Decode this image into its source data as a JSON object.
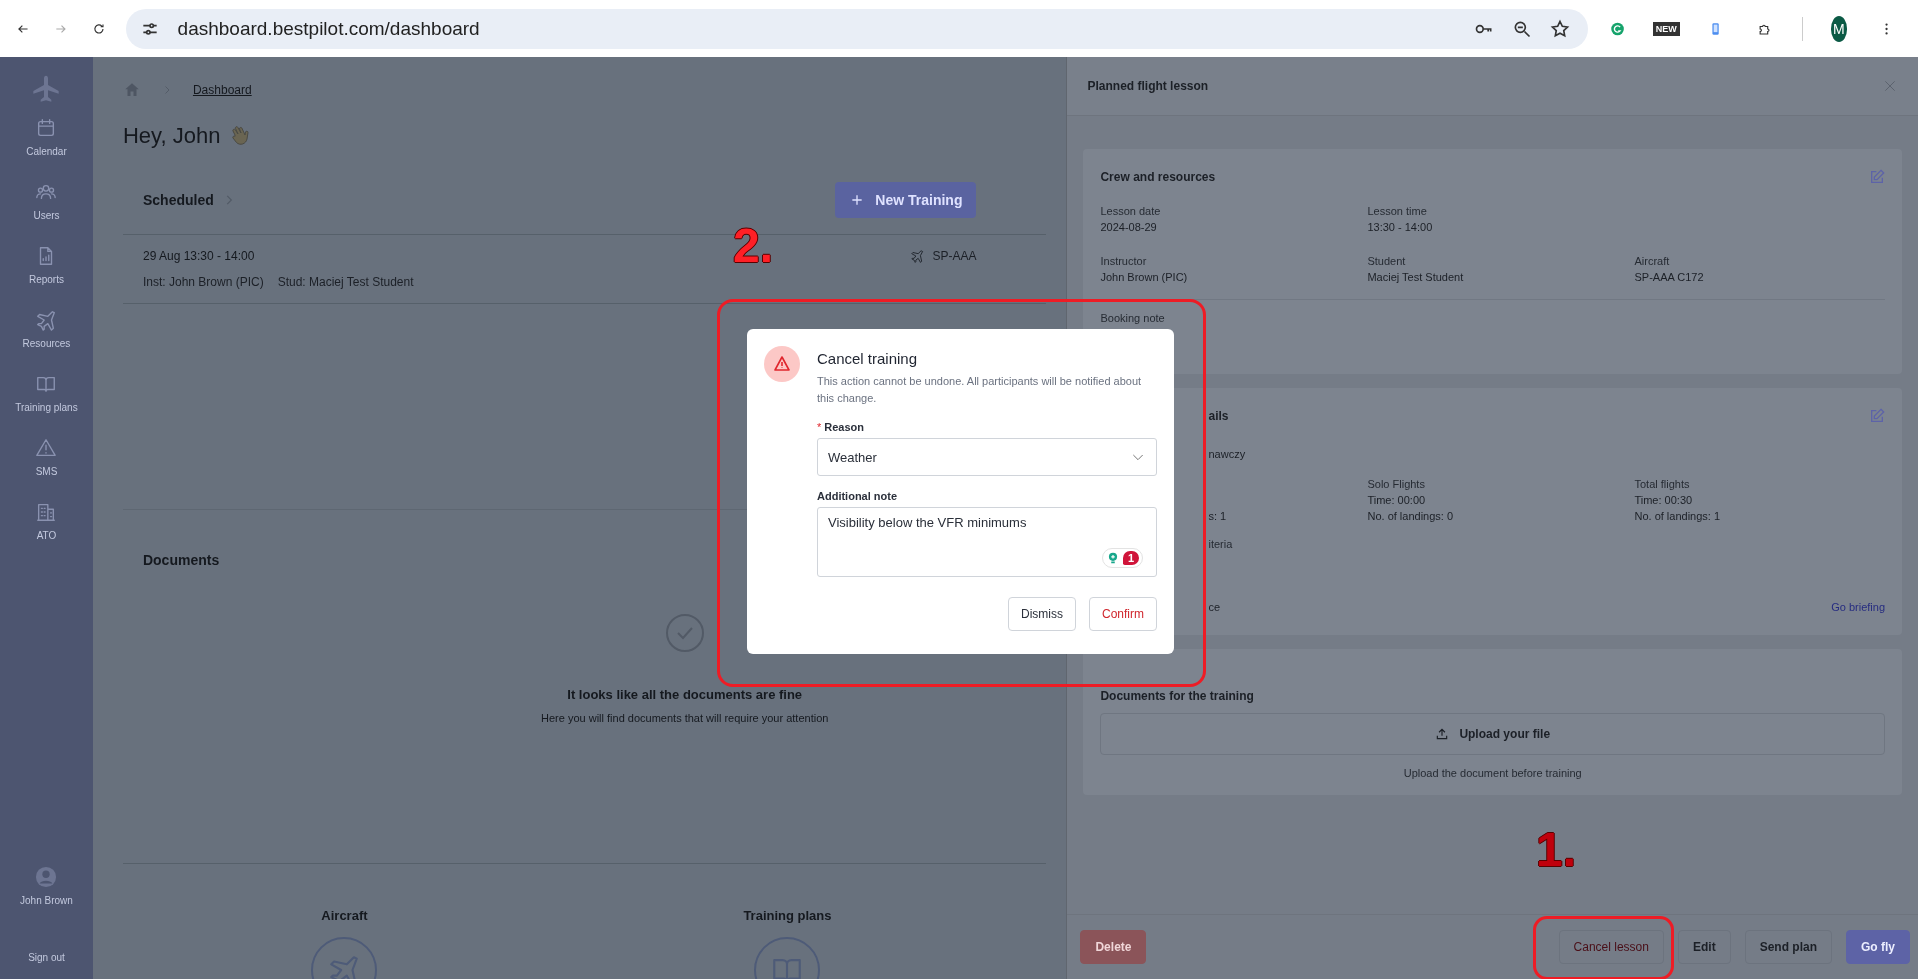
{
  "browser": {
    "url": "dashboard.bestpilot.com/dashboard",
    "extension_badge": "NEW",
    "profile_initial": "M"
  },
  "sidebar": {
    "items": [
      {
        "label": "Calendar",
        "kind": "calendar"
      },
      {
        "label": "Users",
        "kind": "users"
      },
      {
        "label": "Reports",
        "kind": "report"
      },
      {
        "label": "Resources",
        "kind": "plane"
      },
      {
        "label": "Training plans",
        "kind": "book"
      },
      {
        "label": "SMS",
        "kind": "warning"
      },
      {
        "label": "ATO",
        "kind": "building"
      }
    ],
    "user": "John Brown",
    "sign_out": "Sign out"
  },
  "breadcrumb": {
    "current": "Dashboard"
  },
  "greeting": "Hey, John",
  "scheduled": {
    "title": "Scheduled",
    "new_button": "New Training",
    "lessons": [
      {
        "time": "29 Aug 13:30 - 14:00",
        "instructor": "Inst: John Brown (PIC)",
        "student": "Stud: Maciej Test Student",
        "aircraft": "SP-AAA"
      }
    ]
  },
  "documents": {
    "title": "Documents",
    "empty_title": "It looks like all the documents are fine",
    "empty_text": "Here you will find documents that will require your attention"
  },
  "bottom_sections": [
    {
      "title": "Aircraft",
      "kind": "plane"
    },
    {
      "title": "Training plans",
      "kind": "book"
    }
  ],
  "panel": {
    "title": "Planned flight lesson",
    "crew": {
      "title": "Crew and resources",
      "rows": [
        [
          {
            "label": "Lesson date",
            "value": "2024-08-29"
          },
          {
            "label": "Lesson time",
            "value": "13:30 - 14:00"
          }
        ],
        [
          {
            "label": "Instructor",
            "value": "John Brown (PIC)"
          },
          {
            "label": "Student",
            "value": "Maciej Test Student"
          },
          {
            "label": "Aircraft",
            "value": "SP-AAA C172"
          }
        ]
      ],
      "booking_note": "Booking note"
    },
    "details": {
      "title_fragment": "ails",
      "program_fragment": "nawczy",
      "dual_fragment": "s: 1",
      "stats": [
        {
          "title": "Solo Flights",
          "time": "Time: 00:00",
          "landings": "No. of landings: 0"
        },
        {
          "title": "Total flights",
          "time": "Time: 00:30",
          "landings": "No. of landings: 1"
        }
      ],
      "criteria_fragment": "iteria",
      "last_fragment": "ce",
      "link": "Go briefing"
    },
    "documents": {
      "title": "Documents for the training",
      "upload": "Upload your file",
      "hint": "Upload the document before training"
    },
    "footer": [
      {
        "label": "Delete",
        "kind": "danger"
      },
      {
        "label": "Cancel lesson",
        "kind": "outline-danger"
      },
      {
        "label": "Edit",
        "kind": "default"
      },
      {
        "label": "Send plan",
        "kind": "default"
      },
      {
        "label": "Go fly",
        "kind": "primary"
      }
    ]
  },
  "modal": {
    "title": "Cancel training",
    "description": "This action cannot be undone. All participants will be notified about this change.",
    "reason_label": "Reason",
    "required_mark": "*",
    "reason_value": "Weather",
    "note_label": "Additional note",
    "note_value": "Visibility below the VFR minimums",
    "grammar_count": "1",
    "buttons": [
      {
        "label": "Dismiss",
        "kind": "default"
      },
      {
        "label": "Confirm",
        "kind": "danger"
      }
    ]
  },
  "annotations": [
    {
      "label": "2."
    },
    {
      "label": "1."
    }
  ]
}
